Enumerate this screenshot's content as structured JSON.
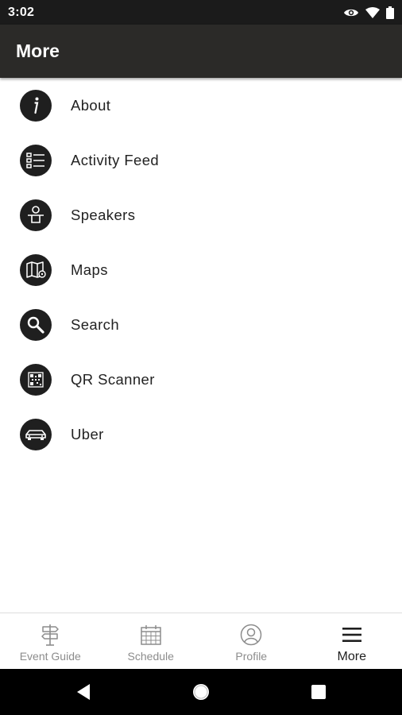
{
  "status_bar": {
    "time": "3:02"
  },
  "app_bar": {
    "title": "More"
  },
  "menu": {
    "items": [
      {
        "label": "About",
        "icon": "info-icon"
      },
      {
        "label": "Activity Feed",
        "icon": "list-icon"
      },
      {
        "label": "Speakers",
        "icon": "speaker-icon"
      },
      {
        "label": "Maps",
        "icon": "map-icon"
      },
      {
        "label": "Search",
        "icon": "search-icon"
      },
      {
        "label": "QR Scanner",
        "icon": "qr-code-icon"
      },
      {
        "label": "Uber",
        "icon": "car-icon"
      }
    ]
  },
  "tabs": [
    {
      "label": "Event Guide",
      "icon": "signpost-icon"
    },
    {
      "label": "Schedule",
      "icon": "calendar-icon"
    },
    {
      "label": "Profile",
      "icon": "profile-icon"
    },
    {
      "label": "More",
      "icon": "menu-icon",
      "active": true
    }
  ],
  "colors": {
    "status_bar": "#1b1b1b",
    "app_bar": "#2b2a28",
    "icon_circle": "#1f1f1f",
    "tab_inactive": "#8c8c8c",
    "tab_active": "#1f1f1f"
  }
}
